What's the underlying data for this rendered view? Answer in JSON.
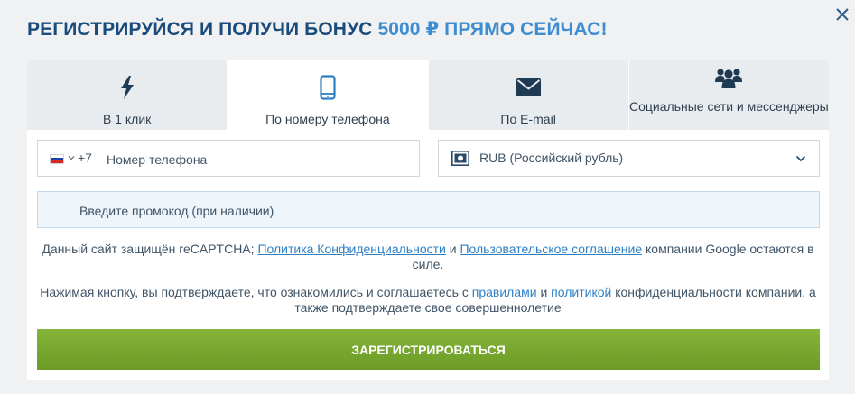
{
  "header": {
    "title_start": "РЕГИСТРИРУЙСЯ И ПОЛУЧИ БОНУС",
    "title_bonus": "5000 ₽",
    "title_end": "ПРЯМО СЕЙЧАС!"
  },
  "tabs": [
    {
      "label": "В 1 клик",
      "icon": "lightning-icon",
      "active": false
    },
    {
      "label": "По номеру телефона",
      "icon": "smartphone-icon",
      "active": true
    },
    {
      "label": "По E-mail",
      "icon": "envelope-icon",
      "active": false
    },
    {
      "label": "Социальные сети и мессенджеры",
      "icon": "users-group-icon",
      "active": false
    }
  ],
  "phone": {
    "country_code": "+7",
    "placeholder": "Номер телефона",
    "flag": "ru-flag"
  },
  "currency": {
    "selected": "RUB (Российский рубль)",
    "icon": "banknote-icon"
  },
  "promo": {
    "placeholder": "Введите промокод (при наличии)"
  },
  "recaptcha": {
    "prefix": "Данный сайт защищён reCAPTCHA;",
    "privacy_link": "Политика Конфиденциальности",
    "and": "и",
    "terms_link": "Пользовательское соглашение",
    "suffix": "компании Google остаются в силе."
  },
  "consent": {
    "prefix": "Нажимая кнопку, вы подтверждаете, что ознакомились и соглашаетесь с",
    "rules_link": "правилами",
    "and": "и",
    "policy_link": "политикой",
    "suffix": "конфиденциальности компании, а также подтверждаете свое совершеннолетие"
  },
  "submit_label": "ЗАРЕГИСТРИРОВАТЬСЯ",
  "colors": {
    "title": "#1a4c7b",
    "accent": "#3d8dd0",
    "link": "#2f7fc4",
    "button": "#7aab33"
  }
}
